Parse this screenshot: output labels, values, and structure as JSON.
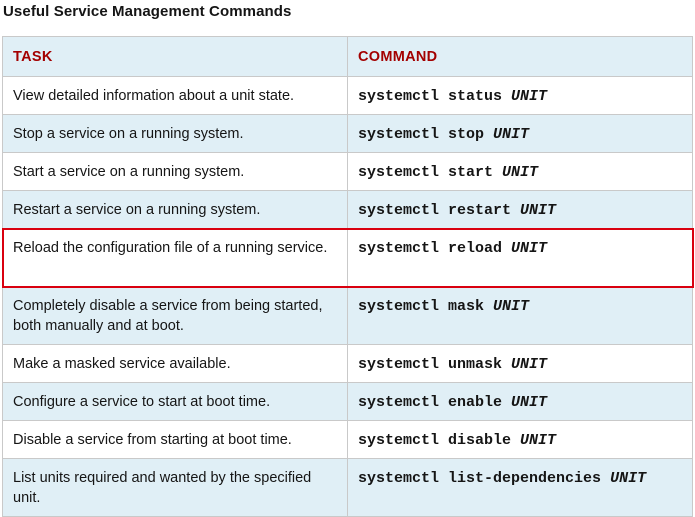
{
  "title": "Useful Service Management Commands",
  "headers": {
    "task": "TASK",
    "command": "COMMAND"
  },
  "rows": [
    {
      "task": "View detailed information about a unit state.",
      "cmd": "systemctl status",
      "arg": "UNIT"
    },
    {
      "task": "Stop a service on a running system.",
      "cmd": "systemctl stop",
      "arg": "UNIT"
    },
    {
      "task": "Start a service on a running system.",
      "cmd": "systemctl start",
      "arg": "UNIT"
    },
    {
      "task": "Restart a service on a running system.",
      "cmd": "systemctl restart",
      "arg": "UNIT"
    },
    {
      "task": "Reload the configuration file of a running service.",
      "cmd": "systemctl reload",
      "arg": "UNIT"
    },
    {
      "task": "Completely disable a service from being started, both manually and at boot.",
      "cmd": "systemctl mask",
      "arg": "UNIT"
    },
    {
      "task": "Make a masked service available.",
      "cmd": "systemctl unmask",
      "arg": "UNIT"
    },
    {
      "task": "Configure a service to start at boot time.",
      "cmd": "systemctl enable",
      "arg": "UNIT"
    },
    {
      "task": "Disable a service from starting at boot time.",
      "cmd": "systemctl disable",
      "arg": "UNIT"
    },
    {
      "task": "List units required and wanted by the specified unit.",
      "cmd": "systemctl list-dependencies",
      "arg": "UNIT"
    }
  ],
  "colors": {
    "header_text": "#a30000",
    "row_shade": "#e0eff6",
    "highlight_border": "#d9000f"
  }
}
